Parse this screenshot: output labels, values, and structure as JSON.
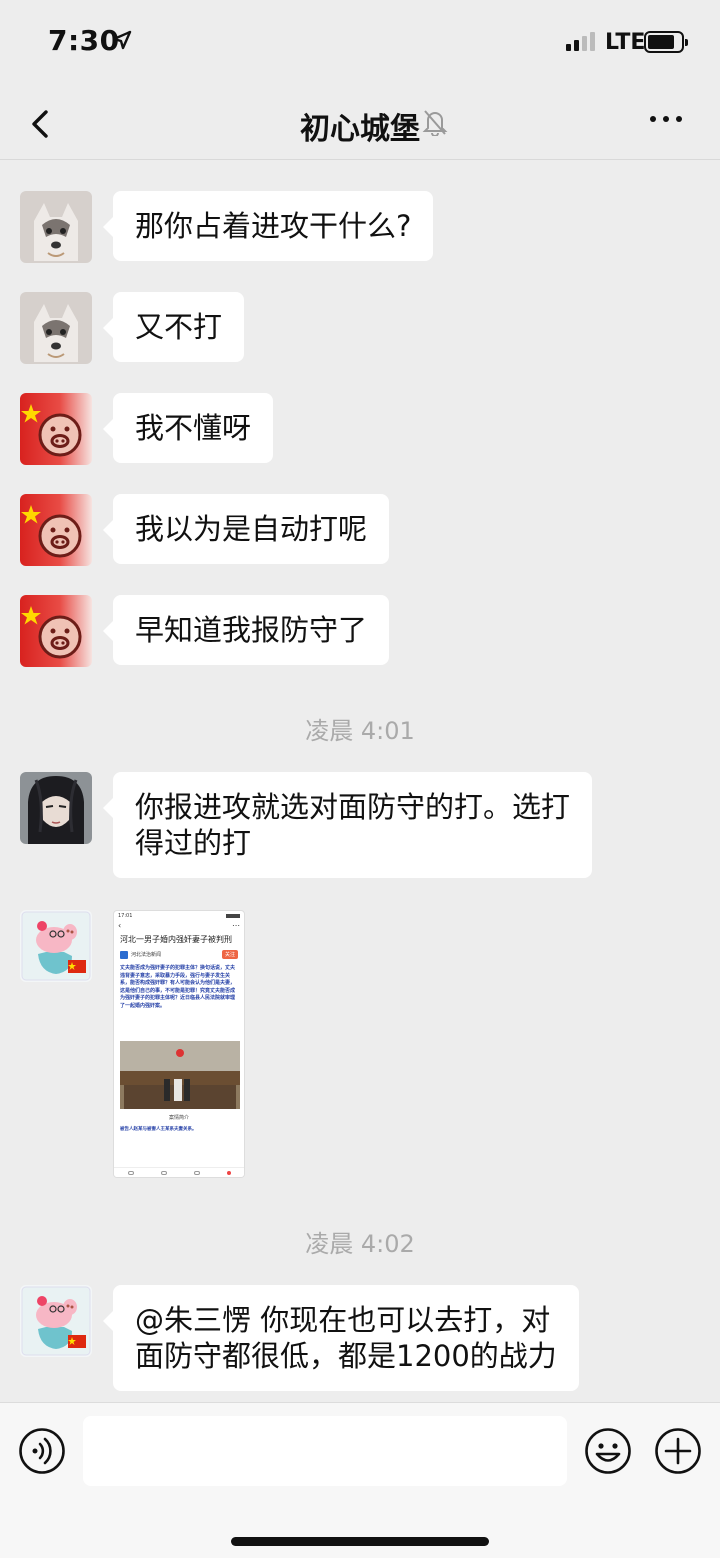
{
  "status_bar": {
    "time": "7:30",
    "network": "LTE",
    "icons": [
      "location-arrow-icon",
      "signal-icon",
      "battery-icon"
    ]
  },
  "nav": {
    "title": "初心城堡",
    "icons": [
      "back-icon",
      "mute-bell-icon",
      "more-icon"
    ]
  },
  "messages": [
    {
      "avatar": "husky-avatar",
      "text": "那你占着进攻干什么?"
    },
    {
      "avatar": "husky-avatar",
      "text": "又不打"
    },
    {
      "avatar": "flag-pig-avatar",
      "text": "我不懂呀"
    },
    {
      "avatar": "flag-pig-avatar",
      "text": "我以为是自动打呢"
    },
    {
      "avatar": "flag-pig-avatar",
      "text": "早知道我报防守了"
    },
    {
      "avatar": "swordsman-avatar",
      "text_line1": "你报进攻就选对面防守的打。选打",
      "text_line2": "得过的打"
    },
    {
      "avatar": "peppa-pig-avatar",
      "mention": "@朱三愣",
      "text_line1": " 你现在也可以去打，对",
      "text_line2": "面防守都很低，都是1200的战力"
    }
  ],
  "time_separators": [
    "凌晨 4:01",
    "凌晨 4:02"
  ],
  "image_message": {
    "avatar": "peppa-pig-avatar",
    "status_time": "17:01",
    "headline": "河北一男子婚内强奸妻子被判刑",
    "source": "河北法治新闻",
    "follow_label": "关注",
    "body": "丈夫能否成为强奸妻子的犯罪主体？换句话说，丈夫违背妻子意志，采取暴力手段，强行与妻子发生关系，能否构成强奸罪？有人可能会认为他们是夫妻，这是他们自己的事，不可能是犯罪！究竟丈夫能否成为强奸妻子的犯罪主体呢？近日临县人民法院就审理了一起婚内强奸案。",
    "caption": "案情简介",
    "footer_text": "被告人赵某与被害人王某系夫妻关系。"
  },
  "input_bar": {
    "icons": [
      "voice-icon",
      "emoji-icon",
      "plus-icon"
    ]
  },
  "colors": {
    "background": "#ededed",
    "bubble": "#ffffff",
    "separator_text": "#aaaaaa"
  }
}
